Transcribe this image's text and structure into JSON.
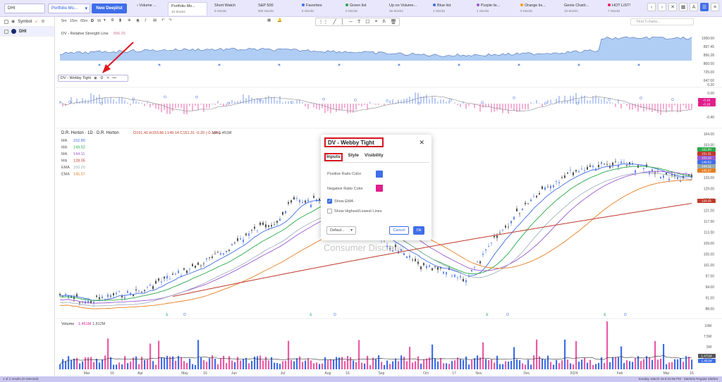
{
  "topbar": {
    "symbol": "DHI",
    "portfolio": "Portfolio Mo...",
    "deeplist": "New Deeplist",
    "tabs": [
      {
        "name": "Volume ...",
        "sub": "",
        "icon": "left-arrow"
      },
      {
        "name": "Portfolio Mo...",
        "sub": "10 Stocks",
        "active": true
      },
      {
        "name": "Short Watch",
        "sub": "9 Stocks"
      },
      {
        "name": "S&P 500",
        "sub": "503 Stocks"
      },
      {
        "name": "Favorites",
        "sub": "8 Stocks",
        "color": "#3f6ee8"
      },
      {
        "name": "Green list",
        "sub": "0 Stocks",
        "color": "#2aa84a"
      },
      {
        "name": "Up on Volume...",
        "sub": "36 Stocks",
        "color": "#888"
      },
      {
        "name": "Blue list",
        "sub": "1 Stocks",
        "color": "#3f6ee8"
      },
      {
        "name": "Purple lis...",
        "sub": "1 Stocks",
        "color": "#9b59d0"
      },
      {
        "name": "Orange lis...",
        "sub": "0 Stocks",
        "color": "#f39c12"
      },
      {
        "name": "Genie Charli...",
        "sub": "19 Stocks"
      },
      {
        "name": "HOT LIST!",
        "sub": "7 Stocks",
        "color": "#e91e63"
      }
    ]
  },
  "leftpanel": {
    "header": "Symbol",
    "rows": [
      "DHI"
    ]
  },
  "toolbar": {
    "timeframes": [
      "5m",
      "15m",
      "65m",
      "D",
      "W"
    ],
    "find_placeholder": "Find 3 charts..."
  },
  "rs_pane": {
    "label": "DV - Relative Strength Line",
    "value": "896.25",
    "price_ticks": [
      "1000.00",
      "897.45",
      "856.28",
      "800.00",
      "725.00",
      "647.00"
    ]
  },
  "webby_pane": {
    "label": "DV - Webby Tight",
    "ticks": [
      "0.20",
      "0.00",
      "-0.16",
      "-0.18",
      "-0.40"
    ]
  },
  "price_pane": {
    "symbol_line": "D.R. Horton · 1D · D.R. Horton",
    "ohlc": "O151.41 H153.86 L149.14 C151.31 -0.20 (-0.13%)",
    "vol": "Vol 1.451M",
    "mas": [
      {
        "name": "MA",
        "value": "152.80",
        "color": "#3f6ee8"
      },
      {
        "name": "MA",
        "value": "149.52",
        "color": "#2aa84a"
      },
      {
        "name": "MA",
        "value": "144.11",
        "color": "#9b59d0"
      },
      {
        "name": "MA",
        "value": "128.05",
        "color": "#c0392b"
      },
      {
        "name": "EMA",
        "value": "150.20",
        "color": "#9aa"
      },
      {
        "name": "EMA",
        "value": "145.57",
        "color": "#e67e22"
      }
    ],
    "ticks": [
      "164.00",
      "153.00",
      "145.00",
      "137.00",
      "133.00",
      "129.00",
      "125.00",
      "121.00",
      "117.00",
      "113.00",
      "109.00",
      "105.00",
      "101.00",
      "97.00",
      "94.00",
      "91.00",
      "88.00"
    ],
    "right_badges": [
      {
        "value": "152.80",
        "color": "#2aa84a"
      },
      {
        "value": "151.31",
        "color": "#c0392b"
      },
      {
        "value": "153.26",
        "color": "#9b59d0"
      },
      {
        "value": "149.52",
        "color": "#3f6ee8"
      },
      {
        "value": "144.11",
        "color": "#9aa"
      },
      {
        "value": "145.57",
        "color": "#e67e22"
      },
      {
        "value": "128.05",
        "color": "#c0392b"
      }
    ],
    "watermark": "Consumer Discretio",
    "event_markers": [
      "E",
      "D",
      "E",
      "D",
      "E",
      "D",
      "E",
      "D"
    ]
  },
  "volume_pane": {
    "label": "Volume",
    "vol1": "1.451M",
    "vol2": "1.812M",
    "ticks": [
      "10M",
      "7.5M",
      "5M",
      "2.5M"
    ],
    "badges": [
      "1.471M",
      "1.451M"
    ]
  },
  "x_axis": [
    "Mar",
    "16",
    "Apr",
    "May",
    "16",
    "Jun",
    "Jul",
    "Aug",
    "16",
    "Sep",
    "Oct",
    "17",
    "Nov",
    "Dec",
    "2024",
    "Feb",
    "Mar",
    "16"
  ],
  "status": {
    "left": "1 of 1 results (0 selected)",
    "right": "Sunday, March 16 8:44:56 PM  ·  Markets Regular Market"
  },
  "dialog": {
    "title": "DV - Webby Tight",
    "tabs": [
      "Inputs",
      "Style",
      "Visibility"
    ],
    "positive_label": "Positive Ratio Color",
    "positive_color": "#3f6ee8",
    "negative_label": "Negative Ratio Color",
    "negative_color": "#e01e8c",
    "show_ema": "Show EMA",
    "show_ema_checked": true,
    "show_hl": "Show Highest/Lowest Lines",
    "show_hl_checked": false,
    "defaults": "Defaul...",
    "cancel": "Cancel",
    "ok": "Ok"
  }
}
